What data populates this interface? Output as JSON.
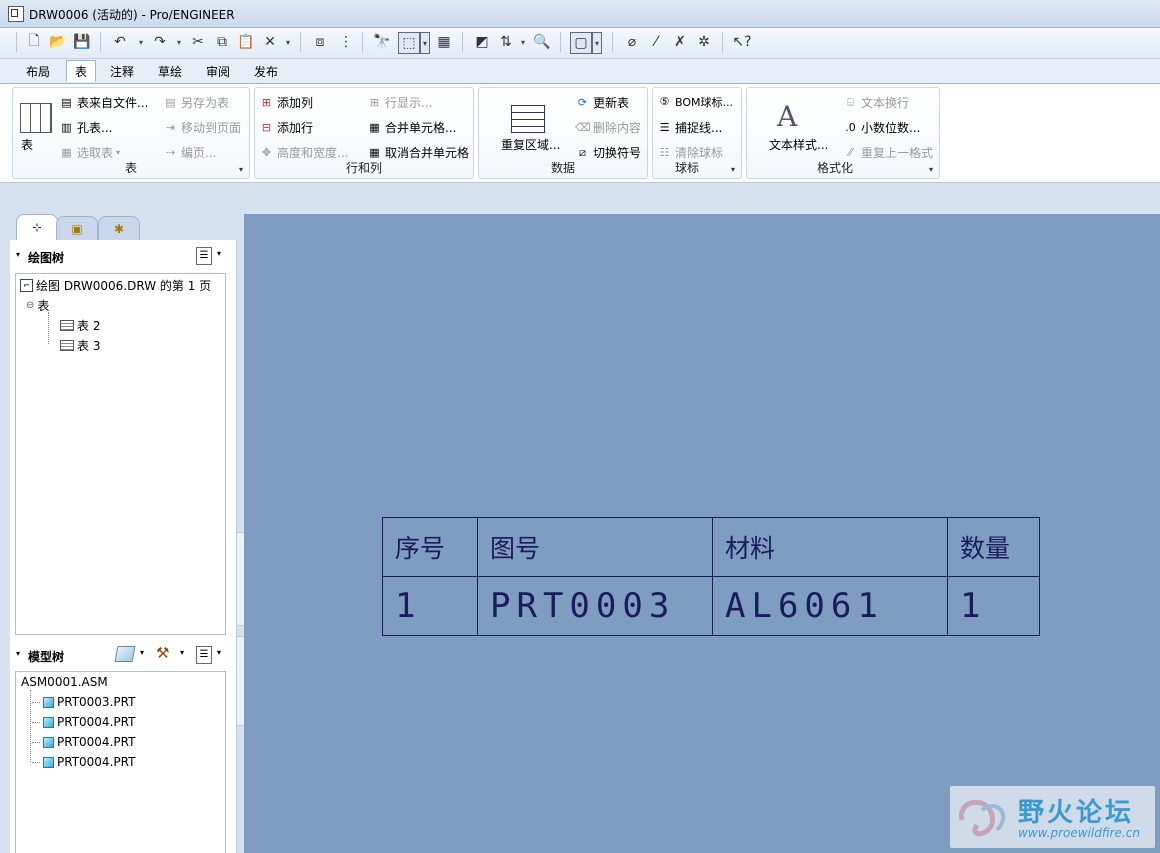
{
  "window": {
    "title": "DRW0006 (活动的) - Pro/ENGINEER"
  },
  "tabs": [
    "布局",
    "表",
    "注释",
    "草绘",
    "审阅",
    "发布"
  ],
  "ribbon": {
    "groups": [
      {
        "title": "表",
        "big": "表",
        "items": [
          {
            "label": "表来自文件...",
            "enabled": true
          },
          {
            "label": "孔表...",
            "enabled": true
          },
          {
            "label": "选取表",
            "enabled": false
          },
          {
            "label": "另存为表",
            "enabled": false
          },
          {
            "label": "移动到页面",
            "enabled": false
          },
          {
            "label": "编页...",
            "enabled": false
          }
        ]
      },
      {
        "title": "行和列",
        "items": [
          {
            "label": "添加列",
            "enabled": true
          },
          {
            "label": "添加行",
            "enabled": true
          },
          {
            "label": "高度和宽度...",
            "enabled": false
          },
          {
            "label": "行显示...",
            "enabled": false
          },
          {
            "label": "合并单元格...",
            "enabled": true
          },
          {
            "label": "取消合并单元格",
            "enabled": true
          }
        ]
      },
      {
        "title": "数据",
        "big": "重复区域...",
        "items": [
          {
            "label": "更新表",
            "enabled": true
          },
          {
            "label": "删除内容",
            "enabled": false
          },
          {
            "label": "切换符号",
            "enabled": true
          }
        ]
      },
      {
        "title": "球标",
        "items": [
          {
            "label": "BOM球标...",
            "enabled": true
          },
          {
            "label": "捕捉线...",
            "enabled": true
          },
          {
            "label": "清除球标",
            "enabled": false
          }
        ]
      },
      {
        "title": "格式化",
        "big": "文本样式...",
        "items": [
          {
            "label": "文本换行",
            "enabled": false
          },
          {
            "label": "小数位数...",
            "enabled": true
          },
          {
            "label": "重复上一格式",
            "enabled": false
          }
        ]
      }
    ]
  },
  "drawing_tree": {
    "title": "绘图树",
    "root": "绘图 DRW0006.DRW 的第 1 页",
    "group": "表",
    "children": [
      "表 2",
      "表 3"
    ]
  },
  "model_tree": {
    "title": "模型树",
    "root": "ASM0001.ASM",
    "children": [
      "PRT0003.PRT",
      "PRT0004.PRT",
      "PRT0004.PRT",
      "PRT0004.PRT"
    ]
  },
  "drawing_table": {
    "headers": [
      "序号",
      "图号",
      "材料",
      "数量"
    ],
    "row": [
      "1",
      "PRT0003",
      "AL6061",
      "1"
    ]
  },
  "watermark": {
    "title": "野火论坛",
    "url": "www.proewildfire.cn"
  }
}
